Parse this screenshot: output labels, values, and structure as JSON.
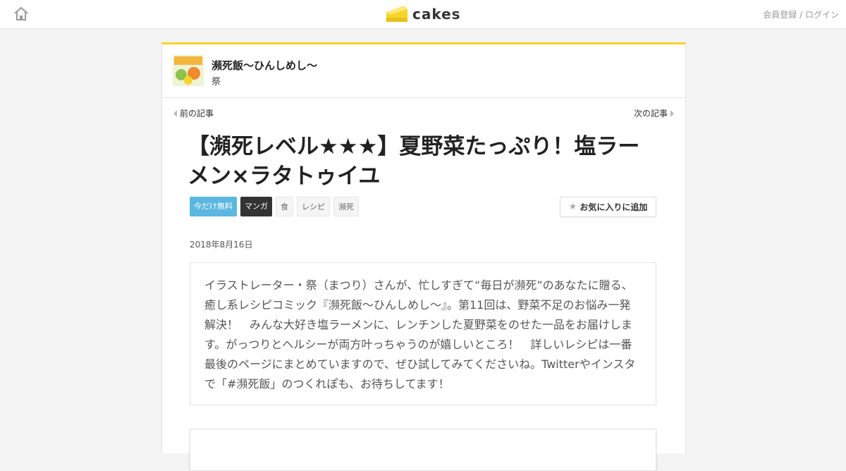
{
  "header": {
    "logo_text": "cakes",
    "auth_register": "会員登録",
    "auth_separator": " / ",
    "auth_login": "ログイン"
  },
  "series": {
    "title": "瀕死飯～ひんしめし～",
    "author": "祭"
  },
  "nav": {
    "prev_label": "前の記事",
    "next_label": "次の記事"
  },
  "article": {
    "title": "【瀕死レベル★★★】夏野菜たっぷり！塩ラーメン×ラタトゥイユ",
    "tags": [
      "今だけ無料",
      "マンガ",
      "食",
      "レシピ",
      "瀕死"
    ],
    "favorite_label": "お気に入りに追加",
    "date": "2018年8月16日",
    "lead": "イラストレーター・祭（まつり）さんが、忙しすぎて“毎日が瀕死”のあなたに贈る、癒し系レシピコミック『瀕死飯～ひんしめし～』。第11回は、野菜不足のお悩み一発解決！　みんな大好き塩ラーメンに、レンチンした夏野菜をのせた一品をお届けします。がっつりとヘルシーが両方叶っちゃうのが嬉しいところ！　詳しいレシピは一番最後のページにまとめていますので、ぜひ試してみてくださいね。Twitterやインスタで「#瀕死飯」のつくれぽも、お待ちしてます！"
  },
  "colors": {
    "accent": "#f5d52c",
    "tag_free": "#5bb7df",
    "tag_manga": "#333333"
  }
}
